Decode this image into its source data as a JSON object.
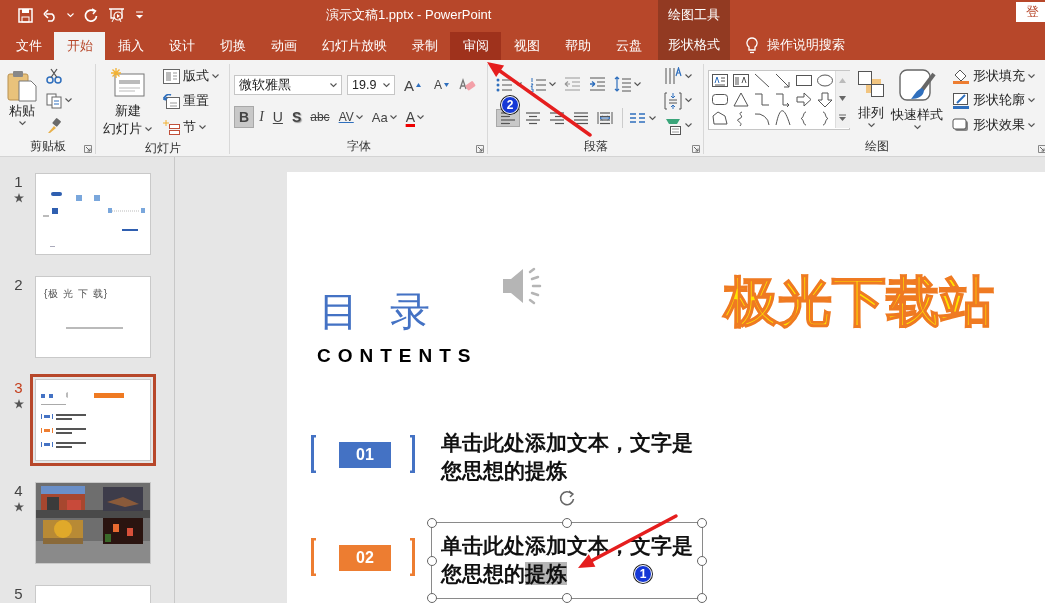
{
  "window": {
    "title": "演示文稿1.pptx  -  PowerPoint",
    "tool_group": "绘图工具",
    "sign_in": "登"
  },
  "tabs": [
    {
      "label": "文件",
      "selected": false,
      "highlighted": false,
      "kind": "normal"
    },
    {
      "label": "开始",
      "selected": true,
      "highlighted": false,
      "kind": "normal"
    },
    {
      "label": "插入",
      "selected": false,
      "highlighted": false,
      "kind": "normal"
    },
    {
      "label": "设计",
      "selected": false,
      "highlighted": false,
      "kind": "normal"
    },
    {
      "label": "切换",
      "selected": false,
      "highlighted": false,
      "kind": "normal"
    },
    {
      "label": "动画",
      "selected": false,
      "highlighted": false,
      "kind": "normal"
    },
    {
      "label": "幻灯片放映",
      "selected": false,
      "highlighted": false,
      "kind": "normal"
    },
    {
      "label": "录制",
      "selected": false,
      "highlighted": false,
      "kind": "normal"
    },
    {
      "label": "审阅",
      "selected": false,
      "highlighted": true,
      "kind": "normal"
    },
    {
      "label": "视图",
      "selected": false,
      "highlighted": false,
      "kind": "normal"
    },
    {
      "label": "帮助",
      "selected": false,
      "highlighted": false,
      "kind": "normal"
    },
    {
      "label": "云盘",
      "selected": false,
      "highlighted": false,
      "kind": "normal"
    },
    {
      "label": "形状格式",
      "selected": false,
      "highlighted": false,
      "kind": "contextual"
    }
  ],
  "search_hint": "操作说明搜索",
  "ribbon": {
    "groups": [
      {
        "kind": "clipboard",
        "label": "剪贴板",
        "paste": "粘贴"
      },
      {
        "kind": "slides",
        "label": "幻灯片",
        "new_slide": [
          "新建",
          "幻灯片"
        ],
        "options": [
          {
            "label": "版式",
            "dropdown": true
          },
          {
            "label": "重置",
            "dropdown": false
          },
          {
            "label": "节",
            "dropdown": true
          }
        ]
      },
      {
        "kind": "font",
        "label": "字体",
        "font_name": "微软雅黑",
        "font_size": "19.9",
        "grow": "A",
        "shrink": "A",
        "format_buttons": [
          {
            "label": "B",
            "selected": true,
            "dropdown": false
          },
          {
            "label": "I",
            "selected": false,
            "dropdown": false
          },
          {
            "label": "U",
            "selected": false,
            "dropdown": false
          },
          {
            "label": "S",
            "selected": false,
            "dropdown": false
          },
          {
            "label": "abc",
            "selected": false,
            "dropdown": false
          },
          {
            "label": "AV",
            "selected": false,
            "dropdown": true
          },
          {
            "label": "Aa",
            "selected": false,
            "dropdown": true
          },
          {
            "label": "A",
            "selected": false,
            "dropdown": true
          }
        ]
      },
      {
        "kind": "paragraph",
        "label": "段落",
        "align_buttons": [
          {
            "selected": true
          },
          {
            "selected": false
          },
          {
            "selected": false
          },
          {
            "selected": false
          },
          {
            "selected": false
          }
        ]
      },
      {
        "kind": "drawing",
        "label": "绘图",
        "arrange": "排列",
        "quick_styles": "快速样式",
        "shape_options": [
          "形状填充",
          "形状轮廓",
          "形状效果"
        ]
      }
    ]
  },
  "slides": [
    {
      "number": "1",
      "starred": true,
      "selected": false,
      "kind": "title"
    },
    {
      "number": "2",
      "starred": false,
      "selected": false,
      "kind": "text",
      "caption": "{极 光 下 载}"
    },
    {
      "number": "3",
      "starred": true,
      "selected": true,
      "kind": "contents"
    },
    {
      "number": "4",
      "starred": true,
      "selected": false,
      "kind": "photos"
    },
    {
      "number": "5",
      "starred": false,
      "selected": false,
      "kind": "blank"
    }
  ],
  "slide": {
    "title": "目 录",
    "subtitle": "CONTENTS",
    "brand": "极光下载站",
    "items": [
      {
        "number": "01",
        "color": "#4472c4",
        "line1": "单击此处添加文本，文字是",
        "line2": "您思想的提炼",
        "selected": false
      },
      {
        "number": "02",
        "color": "#ed7d31",
        "line1": "单击此处添加文本，文字是",
        "line2": "您思想的",
        "selected_text": "提炼",
        "selected": true
      }
    ]
  },
  "annotations": [
    {
      "number": "2"
    },
    {
      "number": "1"
    }
  ]
}
